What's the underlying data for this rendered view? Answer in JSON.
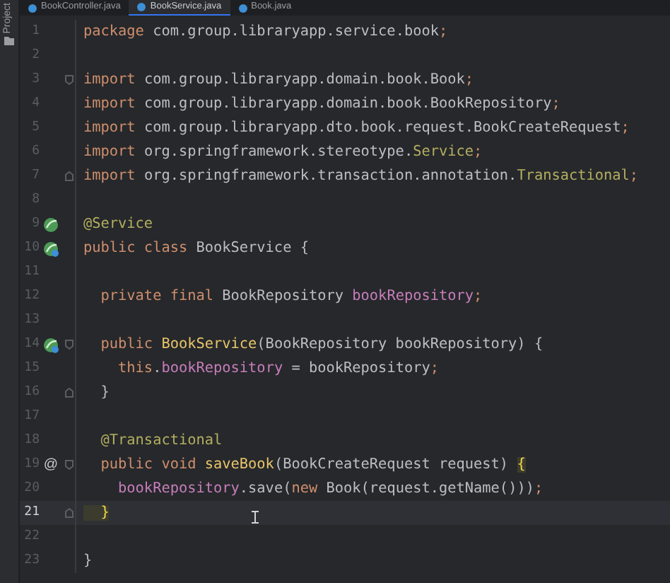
{
  "sidebar": {
    "label": "Project"
  },
  "tabs": [
    {
      "label": "BookController.java",
      "selected": false
    },
    {
      "label": "BookService.java",
      "selected": true
    },
    {
      "label": "Book.java",
      "selected": false
    }
  ],
  "lines": [
    {
      "number": "1",
      "current": false,
      "bean": false,
      "linked": false,
      "fold_start": false,
      "fold_end": false,
      "tokens": [
        {
          "text": "package ",
          "kind": "keyword"
        },
        {
          "text": "com.group.libraryapp.service.book",
          "kind": "plain"
        },
        {
          "text": ";",
          "kind": "keyword"
        }
      ]
    },
    {
      "number": "2",
      "current": false,
      "bean": false,
      "linked": false,
      "fold_start": false,
      "fold_end": false
    },
    {
      "number": "3",
      "current": false,
      "bean": false,
      "linked": false,
      "fold_start": true,
      "fold_end": false,
      "tokens": [
        {
          "text": "import ",
          "kind": "keyword"
        },
        {
          "text": "com.group.libraryapp.domain.book.Book",
          "kind": "plain"
        },
        {
          "text": ";",
          "kind": "keyword"
        }
      ]
    },
    {
      "number": "4",
      "current": false,
      "bean": false,
      "linked": false,
      "fold_start": false,
      "fold_end": false,
      "tokens": [
        {
          "text": "import ",
          "kind": "keyword"
        },
        {
          "text": "com.group.libraryapp.domain.book.BookRepository",
          "kind": "plain"
        },
        {
          "text": ";",
          "kind": "keyword"
        }
      ]
    },
    {
      "number": "5",
      "current": false,
      "bean": false,
      "linked": false,
      "fold_start": false,
      "fold_end": false,
      "tokens": [
        {
          "text": "import ",
          "kind": "keyword"
        },
        {
          "text": "com.group.libraryapp.dto.book.request.BookCreateRequest",
          "kind": "plain"
        },
        {
          "text": ";",
          "kind": "keyword"
        }
      ]
    },
    {
      "number": "6",
      "current": false,
      "bean": false,
      "linked": false,
      "fold_start": false,
      "fold_end": false,
      "tokens": [
        {
          "text": "import ",
          "kind": "keyword"
        },
        {
          "text": "org.springframework.stereotype.",
          "kind": "plain"
        },
        {
          "text": "Service",
          "kind": "annotation"
        },
        {
          "text": ";",
          "kind": "keyword"
        }
      ]
    },
    {
      "number": "7",
      "current": false,
      "bean": false,
      "linked": false,
      "fold_start": false,
      "fold_end": true,
      "tokens": [
        {
          "text": "import ",
          "kind": "keyword"
        },
        {
          "text": "org.springframework.transaction.annotation.",
          "kind": "plain"
        },
        {
          "text": "Transactional",
          "kind": "annotation"
        },
        {
          "text": ";",
          "kind": "keyword"
        }
      ]
    },
    {
      "number": "8",
      "current": false,
      "bean": false,
      "linked": false,
      "fold_start": false,
      "fold_end": false
    },
    {
      "number": "9",
      "current": false,
      "bean": true,
      "linked": false,
      "fold_start": false,
      "fold_end": false,
      "tokens": [
        {
          "text": "@Service",
          "kind": "annotation"
        }
      ]
    },
    {
      "number": "10",
      "current": false,
      "bean": true,
      "linked": true,
      "fold_start": false,
      "fold_end": false,
      "tokens": [
        {
          "text": "public class ",
          "kind": "keyword"
        },
        {
          "text": "BookService {",
          "kind": "plain"
        }
      ]
    },
    {
      "number": "11",
      "current": false,
      "bean": false,
      "linked": false,
      "fold_start": false,
      "fold_end": false
    },
    {
      "number": "12",
      "current": false,
      "bean": false,
      "linked": false,
      "fold_start": false,
      "fold_end": false,
      "tokens": [
        {
          "text": "  private final ",
          "kind": "keyword"
        },
        {
          "text": "BookRepository ",
          "kind": "plain"
        },
        {
          "text": "bookRepository",
          "kind": "field"
        },
        {
          "text": ";",
          "kind": "keyword"
        }
      ]
    },
    {
      "number": "13",
      "current": false,
      "bean": false,
      "linked": false,
      "fold_start": false,
      "fold_end": false
    },
    {
      "number": "14",
      "current": false,
      "bean": true,
      "linked": true,
      "fold_start": true,
      "fold_end": false,
      "tokens": [
        {
          "text": "  public ",
          "kind": "keyword"
        },
        {
          "text": "BookService",
          "kind": "declaration"
        },
        {
          "text": "(BookRepository bookRepository) {",
          "kind": "plain"
        }
      ]
    },
    {
      "number": "15",
      "current": false,
      "bean": false,
      "linked": false,
      "fold_start": false,
      "fold_end": false,
      "tokens": [
        {
          "text": "    this",
          "kind": "keyword"
        },
        {
          "text": ".",
          "kind": "plain"
        },
        {
          "text": "bookRepository",
          "kind": "field"
        },
        {
          "text": " = bookRepository",
          "kind": "plain"
        },
        {
          "text": ";",
          "kind": "keyword"
        }
      ]
    },
    {
      "number": "16",
      "current": false,
      "bean": false,
      "linked": false,
      "fold_start": false,
      "fold_end": true,
      "tokens": [
        {
          "text": "  }",
          "kind": "plain"
        }
      ]
    },
    {
      "number": "17",
      "current": false,
      "bean": false,
      "linked": false,
      "fold_start": false,
      "fold_end": false
    },
    {
      "number": "18",
      "current": false,
      "bean": false,
      "linked": false,
      "fold_start": false,
      "fold_end": false,
      "tokens": [
        {
          "text": "  @Transactional",
          "kind": "annotation"
        }
      ]
    },
    {
      "number": "19",
      "current": false,
      "bean": false,
      "linked": false,
      "fold_start": true,
      "fold_end": false,
      "gutter_text": "@",
      "tokens": [
        {
          "text": "  public void ",
          "kind": "keyword"
        },
        {
          "text": "saveBook",
          "kind": "declaration"
        },
        {
          "text": "(BookCreateRequest request) ",
          "kind": "plain"
        },
        {
          "text": "{",
          "kind": "brace-match"
        }
      ]
    },
    {
      "number": "20",
      "current": false,
      "bean": false,
      "linked": false,
      "fold_start": false,
      "fold_end": false,
      "tokens": [
        {
          "text": "    bookRepository",
          "kind": "field"
        },
        {
          "text": ".save(",
          "kind": "plain"
        },
        {
          "text": "new ",
          "kind": "keyword"
        },
        {
          "text": "Book(request.getName()))",
          "kind": "plain"
        },
        {
          "text": ";",
          "kind": "keyword"
        }
      ]
    },
    {
      "number": "21",
      "current": true,
      "bean": false,
      "linked": false,
      "fold_start": false,
      "fold_end": true,
      "tokens": [
        {
          "text": "  }",
          "kind": "brace-match"
        }
      ]
    },
    {
      "number": "22",
      "current": false,
      "bean": false,
      "linked": false,
      "fold_start": false,
      "fold_end": false
    },
    {
      "number": "23",
      "current": false,
      "bean": false,
      "linked": false,
      "fold_start": false,
      "fold_end": false,
      "tokens": [
        {
          "text": "}",
          "kind": "plain"
        }
      ]
    }
  ]
}
